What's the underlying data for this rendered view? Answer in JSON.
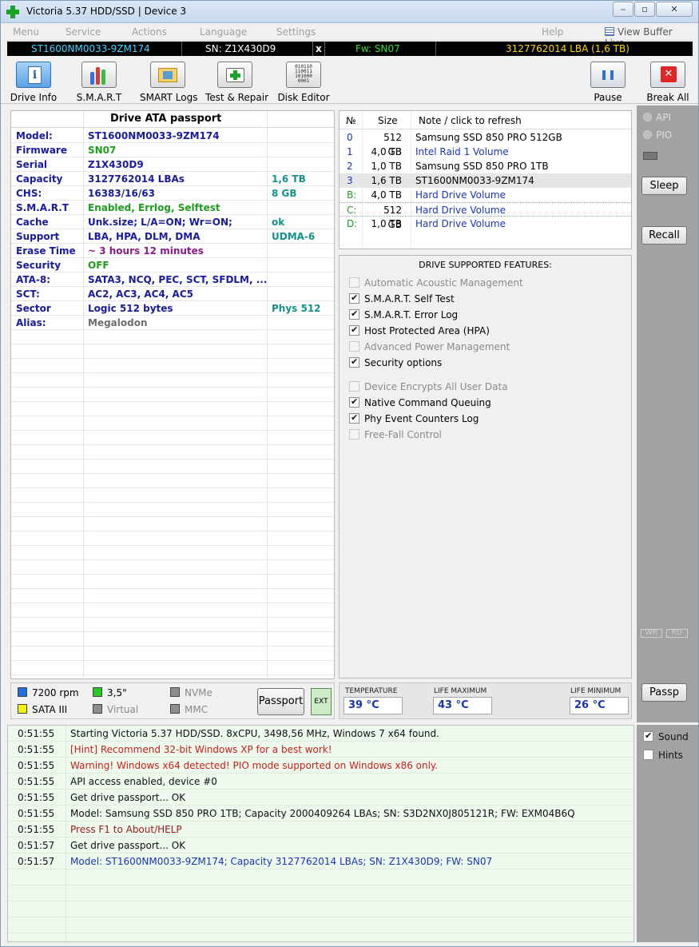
{
  "window": {
    "title": "Victoria 5.37 HDD/SSD | Device 3",
    "controls": {
      "min": "‒",
      "max": "▫",
      "close": "✕"
    }
  },
  "menu": {
    "items": [
      "Menu",
      "Service",
      "Actions",
      "Language",
      "Settings",
      "Help"
    ],
    "view_buffer_live": "View Buffer Live"
  },
  "device_bar": {
    "model": "ST1600NM0033-9ZM174",
    "sn": "SN: Z1X430D9",
    "x": "x",
    "fw": "Fw: SN07",
    "lba": "3127762014 LBA (1,6 TB)",
    "colors": {
      "model": "#3dd6ff",
      "fw": "#35e035",
      "lba": "#ffd700"
    }
  },
  "toolbar": {
    "drive_info": "Drive Info",
    "smart": "S.M.A.R.T",
    "smart_logs": "SMART Logs",
    "test_repair": "Test & Repair",
    "disk_editor": "Disk Editor",
    "pause": "Pause",
    "break_all": "Break All",
    "disk_editor_binary": [
      "010110",
      "110011",
      "101000",
      "0001"
    ]
  },
  "passport": {
    "title": "Drive ATA passport",
    "rows": [
      {
        "key": "Model:",
        "value": "ST1600NM0033-9ZM174",
        "extra": ""
      },
      {
        "key": "Firmware",
        "value": "SN07",
        "extra": ""
      },
      {
        "key": "Serial",
        "value": "Z1X430D9",
        "extra": ""
      },
      {
        "key": "Capacity",
        "value": "3127762014 LBAs",
        "extra": "1,6 TB"
      },
      {
        "key": "CHS:",
        "value": "16383/16/63",
        "extra": "8 GB"
      },
      {
        "key": "S.M.A.R.T",
        "value": "Enabled, Errlog, Selftest",
        "extra": ""
      },
      {
        "key": "Cache",
        "value": "Unk.size; L/A=ON; Wr=ON;",
        "extra": "ok"
      },
      {
        "key": "Support",
        "value": "LBA, HPA, DLM, DMA",
        "extra": "UDMA-6"
      },
      {
        "key": "Erase Time",
        "value": "~ 3 hours 12 minutes",
        "extra": ""
      },
      {
        "key": "Security",
        "value": "OFF",
        "extra": ""
      },
      {
        "key": "ATA-8:",
        "value": "SATA3, NCQ, PEC, SCT, SFDLM, ...",
        "extra": ""
      },
      {
        "key": "SCT:",
        "value": "AC2, AC3, AC4, AC5",
        "extra": ""
      },
      {
        "key": "Sector",
        "value": "Logic 512 bytes",
        "extra": "Phys 512"
      },
      {
        "key": "Alias:",
        "value": "Megalodon",
        "extra": ""
      }
    ],
    "value_colors": [
      "#1a1a9c",
      "#1e9c1e",
      "#1a1a9c",
      "#1a1a9c",
      "#1a1a9c",
      "#1e9c1e",
      "#1a1a9c",
      "#1a1a9c",
      "#8a1a8a",
      "#1e9c1e",
      "#1a1a9c",
      "#1a1a9c",
      "#1a1a9c",
      "#6e6e6e"
    ]
  },
  "drives": {
    "headers": {
      "num": "№",
      "size": "Size",
      "note": "Note / click to refresh"
    },
    "rows": [
      {
        "num": "0",
        "size": "512 GB",
        "note": "Samsung SSD 850 PRO 512GB",
        "note_color": "#000"
      },
      {
        "num": "1",
        "size": "4,0 TB",
        "note": "Intel    Raid 1 Volume",
        "note_color": "#1b34b8"
      },
      {
        "num": "2",
        "size": "1,0 TB",
        "note": "Samsung SSD 850 PRO 1TB",
        "note_color": "#000"
      },
      {
        "num": "3",
        "size": "1,6 TB",
        "note": "ST1600NM0033-9ZM174",
        "note_color": "#000"
      },
      {
        "num": "B:",
        "size": "4,0 TB",
        "note": "Hard Drive Volume",
        "note_color": "#1b34b8"
      },
      {
        "num": "C:",
        "size": "512 GB",
        "note": "Hard Drive Volume",
        "note_color": "#1b34b8"
      },
      {
        "num": "D:",
        "size": "1,0 TB",
        "note": "Hard Drive Volume",
        "note_color": "#1b34b8"
      }
    ]
  },
  "features": {
    "title": "DRIVE SUPPORTED FEATURES:",
    "items": [
      {
        "label": "Automatic Acoustic Management",
        "checked": false,
        "enabled": false
      },
      {
        "label": "S.M.A.R.T. Self Test",
        "checked": true,
        "enabled": true
      },
      {
        "label": "S.M.A.R.T. Error Log",
        "checked": true,
        "enabled": true
      },
      {
        "label": "Host Protected Area (HPA)",
        "checked": true,
        "enabled": true
      },
      {
        "label": "Advanced Power Management",
        "checked": false,
        "enabled": false
      },
      {
        "label": "Security options",
        "checked": true,
        "enabled": true
      },
      {
        "label": "Device Encrypts All User Data",
        "checked": false,
        "enabled": false
      },
      {
        "label": "Native Command Queuing",
        "checked": true,
        "enabled": true
      },
      {
        "label": "Phy Event Counters Log",
        "checked": true,
        "enabled": true
      },
      {
        "label": "Free-Fall Control",
        "checked": false,
        "enabled": false
      }
    ]
  },
  "sidebar": {
    "api": "API",
    "pio": "PIO",
    "sleep": "Sleep",
    "recall": "Recall",
    "wr": "WR",
    "rd": "RD",
    "passp": "Passp"
  },
  "legend": {
    "rpm": "7200 rpm",
    "form": "3,5\"",
    "nvme": "NVMe",
    "sata": "SATA III",
    "virtual": "Virtual",
    "mmc": "MMC",
    "passport_btn": "Passport",
    "ext_btn": "EXT",
    "colors": {
      "rpm": "#1e6ee6",
      "form": "#22cc22",
      "sata": "#f2f200",
      "gray": "#8e8e8e"
    }
  },
  "temps": {
    "temperature_label": "TEMPERATURE",
    "temperature": "39 °C",
    "life_max_label": "LIFE MAXIMUM",
    "life_max": "43 °C",
    "life_min_label": "LIFE MINIMUM",
    "life_min": "26 °C"
  },
  "log": {
    "rows": [
      {
        "time": "0:51:55",
        "msg": "Starting Victoria 5.37 HDD/SSD. 8xCPU, 3498,56 MHz, Windows 7 x64 found.",
        "color": "#111111"
      },
      {
        "time": "0:51:55",
        "msg": "[Hint] Recommend 32-bit Windows XP for a best work!",
        "color": "#c8201a"
      },
      {
        "time": "0:51:55",
        "msg": "Warning! Windows x64 detected! PIO mode supported on Windows x86 only.",
        "color": "#c8201a"
      },
      {
        "time": "0:51:55",
        "msg": "API access enabled, device #0",
        "color": "#111111"
      },
      {
        "time": "0:51:55",
        "msg": "Get drive passport... OK",
        "color": "#111111"
      },
      {
        "time": "0:51:55",
        "msg": "Model: Samsung SSD 850 PRO 1TB; Capacity 2000409264 LBAs; SN: S3D2NX0J805121R; FW: EXM04B6Q",
        "color": "#111111"
      },
      {
        "time": "0:51:55",
        "msg": "Press F1 to About/HELP",
        "color": "#9a1a1a"
      },
      {
        "time": "0:51:57",
        "msg": "Get drive passport... OK",
        "color": "#111111"
      },
      {
        "time": "0:51:57",
        "msg": "Model: ST1600NM0033-9ZM174; Capacity 3127762014 LBAs; SN: Z1X430D9; FW: SN07",
        "color": "#1b34b8"
      }
    ],
    "sound": "Sound",
    "hints": "Hints",
    "sound_checked": true,
    "hints_checked": false
  }
}
